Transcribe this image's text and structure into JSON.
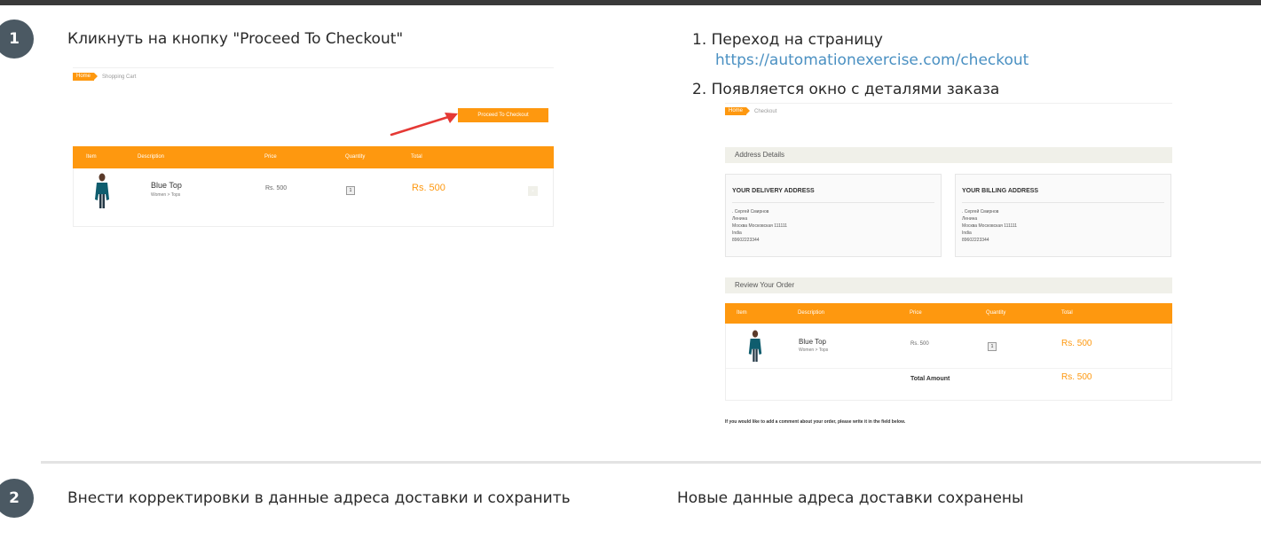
{
  "steps": [
    {
      "number": "1",
      "action": "Кликнуть на кнопку \"Proceed To Checkout\"",
      "results": [
        {
          "text": "1. Переход на страницу",
          "link": "https://automationexercise.com/checkout"
        },
        {
          "text": "2. Появляется окно с деталями заказа"
        }
      ]
    },
    {
      "number": "2",
      "action": "Внести корректировки в данные адреса доставки и сохранить",
      "result": "Новые данные адреса доставки сохранены"
    }
  ],
  "cart_screenshot": {
    "breadcrumb": {
      "home": "Home",
      "current": "Shopping Cart"
    },
    "proceed_button": "Proceed To Checkout",
    "columns": [
      "Item",
      "Description",
      "Price",
      "Quantity",
      "Total"
    ],
    "row": {
      "name": "Blue Top",
      "category": "Women > Tops",
      "price": "Rs. 500",
      "quantity": "1",
      "total": "Rs. 500",
      "delete": "×"
    }
  },
  "checkout_screenshot": {
    "breadcrumb": {
      "home": "Home",
      "current": "Checkout"
    },
    "address_section": "Address Details",
    "delivery": {
      "title": "YOUR DELIVERY ADDRESS",
      "lines": [
        ". Сергей Смирнов",
        "Ленина",
        "Москва Московская 111111",
        "India",
        "89602223344"
      ]
    },
    "billing": {
      "title": "YOUR BILLING ADDRESS",
      "lines": [
        ". Сергей Смирнов",
        "Ленина",
        "Москва Московская 111111",
        "India",
        "89602223344"
      ]
    },
    "review_section": "Review Your Order",
    "columns": [
      "Item",
      "Description",
      "Price",
      "Quantity",
      "Total"
    ],
    "row": {
      "name": "Blue Top",
      "category": "Women > Tops",
      "price": "Rs. 500",
      "quantity": "1",
      "total": "Rs. 500"
    },
    "total_label": "Total Amount",
    "total_value": "Rs. 500",
    "comment_note": "If you would like to add a comment about your order, please write it in the field below."
  },
  "colors": {
    "accent": "#fe980f",
    "step_badge": "#4b5963",
    "link": "#4a90c2",
    "arrow": "#e53935",
    "section_bg": "#f0f0e9"
  }
}
